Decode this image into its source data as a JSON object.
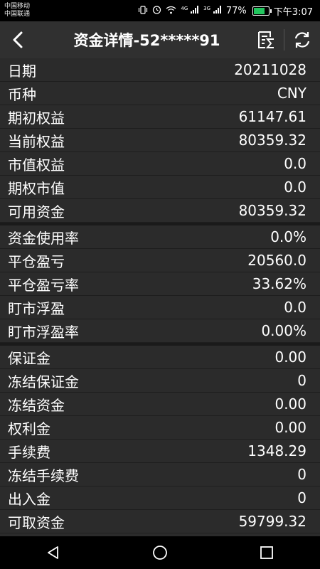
{
  "status_bar": {
    "carrier1": "中国移动",
    "carrier2": "中国联通",
    "signal1_tag": "4G",
    "signal2_tag": "3G",
    "battery": "77%",
    "time": "下午3:07"
  },
  "header": {
    "title": "资金详情-52*****91"
  },
  "groups": [
    {
      "rows": [
        {
          "label": "日期",
          "value": "20211028"
        },
        {
          "label": "币种",
          "value": "CNY"
        },
        {
          "label": "期初权益",
          "value": "61147.61"
        },
        {
          "label": "当前权益",
          "value": "80359.32"
        },
        {
          "label": "市值权益",
          "value": "0.0"
        },
        {
          "label": "期权市值",
          "value": "0.0"
        },
        {
          "label": "可用资金",
          "value": "80359.32"
        }
      ]
    },
    {
      "rows": [
        {
          "label": "资金使用率",
          "value": "0.0%"
        },
        {
          "label": "平仓盈亏",
          "value": "20560.0"
        },
        {
          "label": "平仓盈亏率",
          "value": "33.62%"
        },
        {
          "label": "盯市浮盈",
          "value": "0.0"
        },
        {
          "label": "盯市浮盈率",
          "value": "0.00%"
        }
      ]
    },
    {
      "rows": [
        {
          "label": "保证金",
          "value": "0.00"
        },
        {
          "label": "冻结保证金",
          "value": "0"
        },
        {
          "label": "冻结资金",
          "value": "0.00"
        },
        {
          "label": "权利金",
          "value": "0.00"
        },
        {
          "label": "手续费",
          "value": "1348.29"
        },
        {
          "label": "冻结手续费",
          "value": "0"
        },
        {
          "label": "出入金",
          "value": "0"
        },
        {
          "label": "可取资金",
          "value": "59799.32"
        }
      ]
    }
  ]
}
